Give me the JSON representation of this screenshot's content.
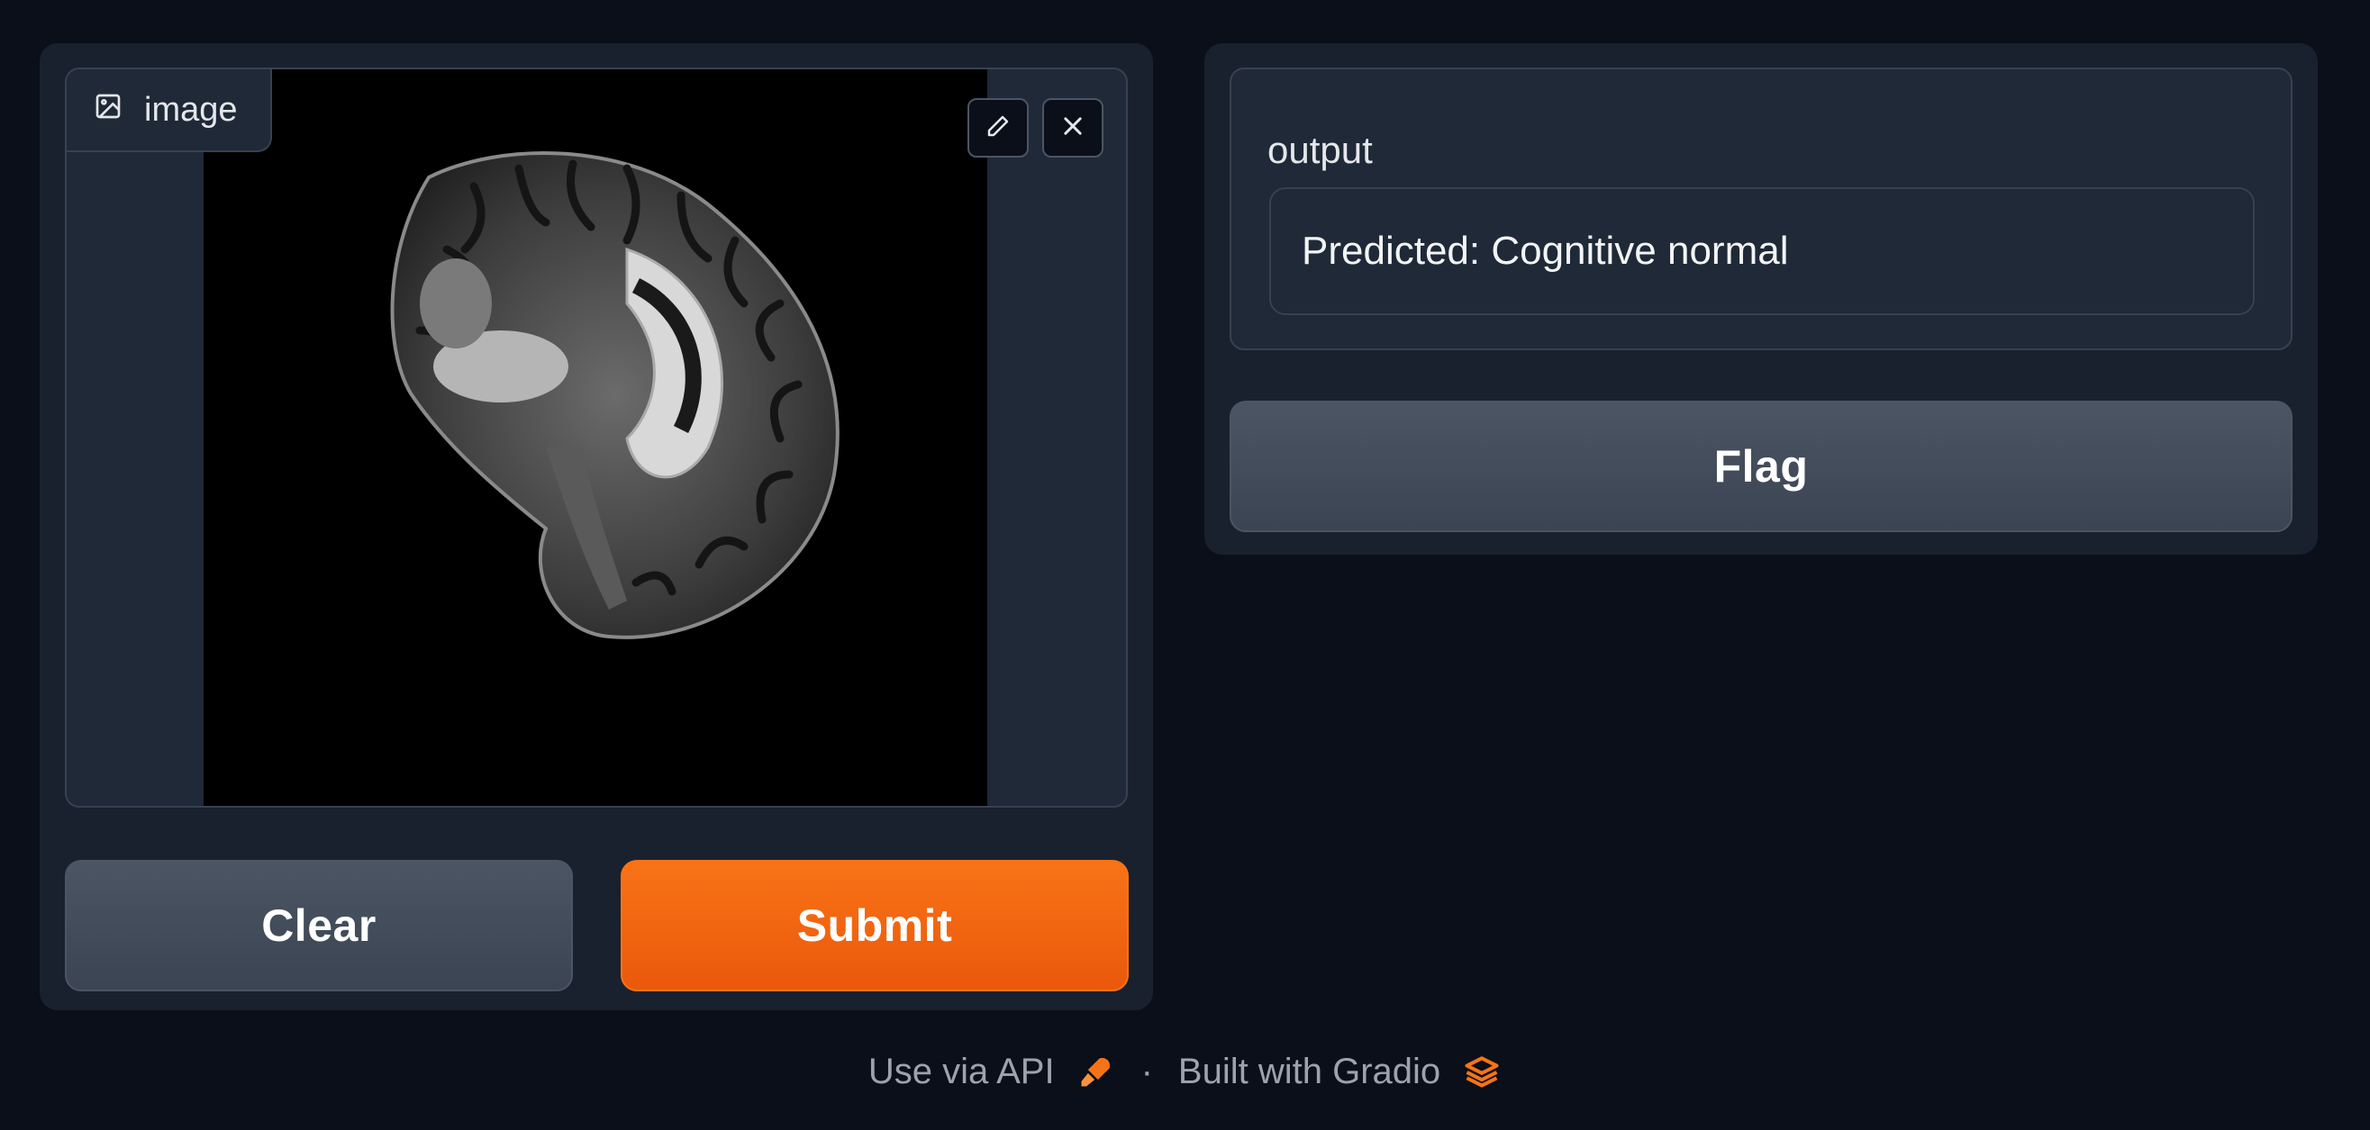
{
  "input": {
    "label": "image",
    "icons": [
      "image-icon",
      "edit-icon",
      "close-icon"
    ]
  },
  "buttons": {
    "clear": "Clear",
    "submit": "Submit",
    "flag": "Flag"
  },
  "output": {
    "label": "output",
    "value": "Predicted: Cognitive normal"
  },
  "footer": {
    "api_link": "Use via API",
    "separator": "·",
    "built_with": "Built with Gradio"
  },
  "colors": {
    "background": "#0b0f19",
    "panel": "#1a212e",
    "primary": "#f97316",
    "secondary": "#4b5563"
  }
}
